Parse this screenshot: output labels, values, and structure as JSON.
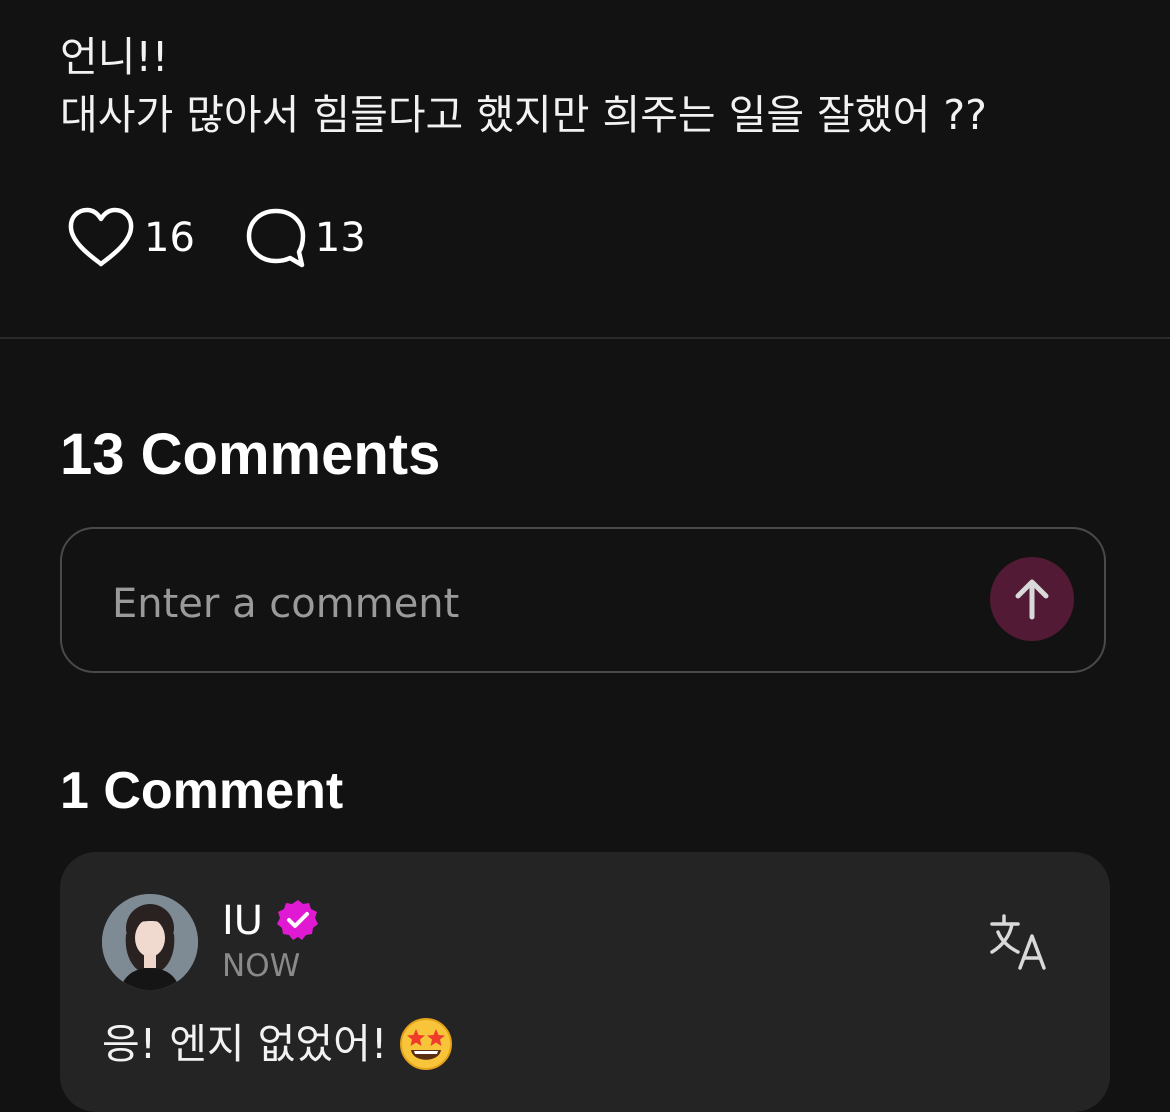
{
  "post": {
    "text_line1": "언니!!",
    "text_line2": "대사가 많아서 힘들다고 했지만 희주는 일을 잘했어 ??",
    "like_count": "16",
    "comment_count": "13"
  },
  "comments_section": {
    "heading": "13 Comments",
    "input_placeholder": "Enter a comment",
    "send_icon": "arrow-up-icon"
  },
  "thread": {
    "heading": "1 Comment",
    "comment": {
      "author": "IU",
      "verified_icon": "verified-badge-icon",
      "timestamp": "NOW",
      "translate_icon": "translate-icon",
      "text": "응! 엔지 없었어!",
      "emoji": "star-struck-emoji"
    }
  },
  "colors": {
    "background": "#121212",
    "card": "#242424",
    "send_button": "#521a34",
    "verified": "#e01ad3",
    "muted_text": "#8a8a8a"
  }
}
